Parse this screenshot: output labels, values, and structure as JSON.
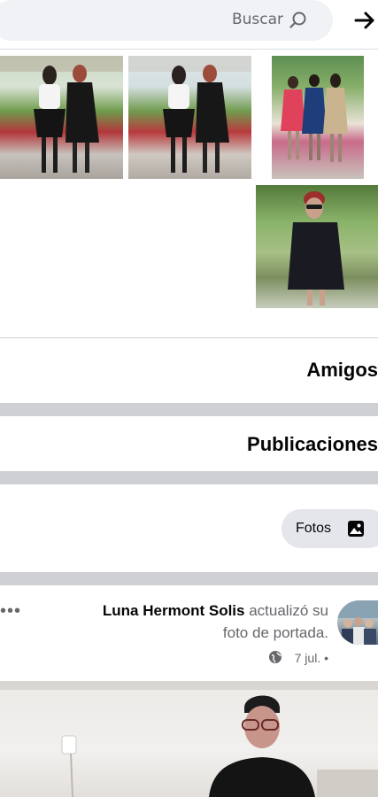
{
  "header": {
    "search_placeholder": "Buscar",
    "icons": [
      "search-icon",
      "back-arrow-icon"
    ]
  },
  "photos": [
    "photo-1",
    "photo-2",
    "photo-3",
    "photo-4"
  ],
  "sections": {
    "friends": "Amigos",
    "posts": "Publicaciones"
  },
  "filter_chip": {
    "label": "Fotos",
    "icon": "photo-icon"
  },
  "post": {
    "author": "Luna Hermont Solis",
    "action_line1": "actualizó su",
    "action_line2": "foto de portada.",
    "date": "7 jul.",
    "separator": "•",
    "audience_icon": "globe-icon",
    "menu": "•••"
  },
  "colors": {
    "divider": "#ced0d4",
    "chip_bg": "#e4e6eb",
    "search_bg": "#f0f2f5",
    "muted_text": "#65676b"
  }
}
